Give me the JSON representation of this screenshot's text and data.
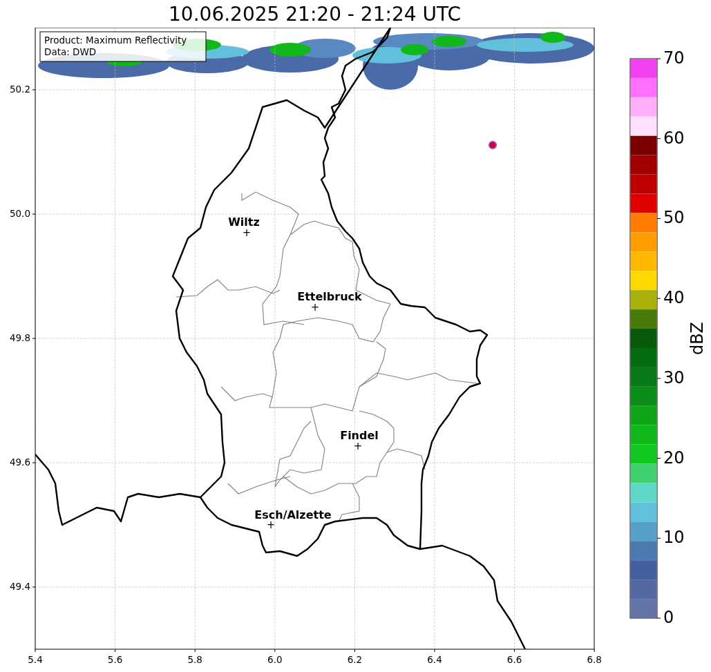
{
  "title": "10.06.2025 21:20 - 21:24 UTC",
  "info_box": {
    "lines": [
      "Product: Maximum Reflectivity",
      "Data: DWD"
    ]
  },
  "map": {
    "y_ticks": [
      "50.2",
      "50.0",
      "49.8",
      "49.6",
      "49.4"
    ],
    "x_ticks": [
      "5.4",
      "5.6",
      "5.8",
      "6.0",
      "6.2",
      "6.4",
      "6.6",
      "6.8"
    ],
    "cities": [
      {
        "name": "Wiltz",
        "marker": "+"
      },
      {
        "name": "Ettelbruck",
        "marker": "+"
      },
      {
        "name": "Findel",
        "marker": "+"
      },
      {
        "name": "Esch/Alzette",
        "marker": "+"
      }
    ]
  },
  "colorbar": {
    "label": "dBZ",
    "ticks": [
      "70",
      "60",
      "50",
      "40",
      "30",
      "20",
      "10",
      "0"
    ],
    "segments": [
      {
        "color": "#f040f0"
      },
      {
        "color": "#ff70ff"
      },
      {
        "color": "#ffb0f8"
      },
      {
        "color": "#ffe0ff"
      },
      {
        "color": "#7a0000"
      },
      {
        "color": "#a00000"
      },
      {
        "color": "#c00000"
      },
      {
        "color": "#e00000"
      },
      {
        "color": "#ff7c00"
      },
      {
        "color": "#ff9c00"
      },
      {
        "color": "#ffb800"
      },
      {
        "color": "#ffd800"
      },
      {
        "color": "#aab00a"
      },
      {
        "color": "#4a7a0a"
      },
      {
        "color": "#065a0a"
      },
      {
        "color": "#066c12"
      },
      {
        "color": "#087818"
      },
      {
        "color": "#0a8c18"
      },
      {
        "color": "#10a418"
      },
      {
        "color": "#10b81c"
      },
      {
        "color": "#10c820"
      },
      {
        "color": "#40d070"
      },
      {
        "color": "#60d8c8"
      },
      {
        "color": "#62c0dc"
      },
      {
        "color": "#56a0c8"
      },
      {
        "color": "#4a7ab0"
      },
      {
        "color": "#4460a0"
      },
      {
        "color": "#5468a2"
      },
      {
        "color": "#6474a6"
      }
    ]
  }
}
